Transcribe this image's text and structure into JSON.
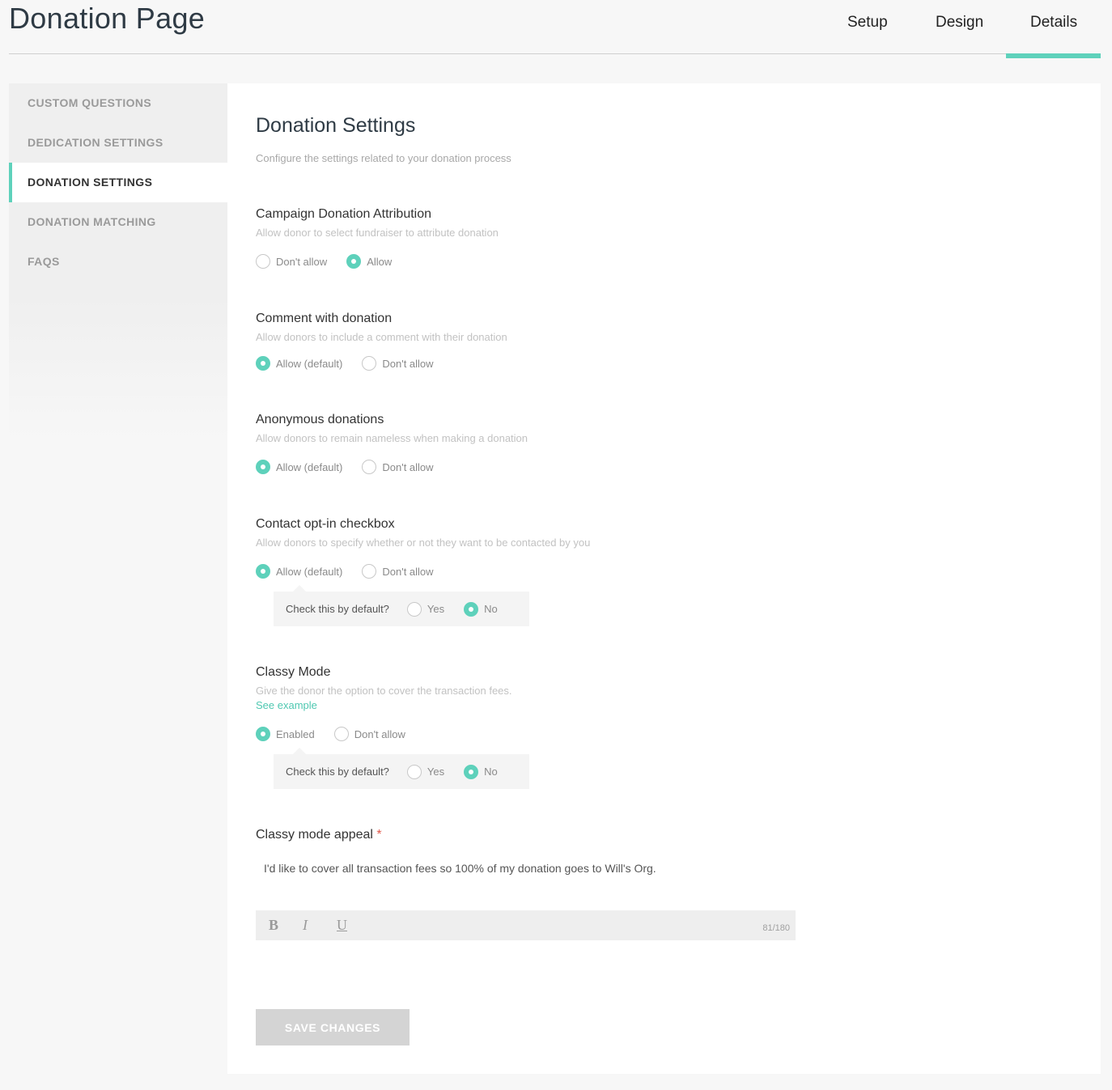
{
  "header": {
    "title": "Donation Page",
    "tabs": [
      {
        "label": "Setup"
      },
      {
        "label": "Design"
      },
      {
        "label": "Details"
      }
    ],
    "active_tab": "Details",
    "accent_color": "#5ed1bb"
  },
  "sidebar": {
    "items": [
      {
        "label": "CUSTOM QUESTIONS"
      },
      {
        "label": "DEDICATION SETTINGS"
      },
      {
        "label": "DONATION SETTINGS"
      },
      {
        "label": "DONATION MATCHING"
      },
      {
        "label": "FAQS"
      }
    ],
    "active": "DONATION SETTINGS"
  },
  "main": {
    "title": "Donation Settings",
    "subtitle": "Configure the settings related to your donation process",
    "sections": {
      "attribution": {
        "title": "Campaign Donation Attribution",
        "desc": "Allow donor to select fundraiser to attribute donation",
        "options": [
          "Don't allow",
          "Allow"
        ],
        "selected": "Allow"
      },
      "comment": {
        "title": "Comment with donation",
        "desc": "Allow donors to include a comment with their donation",
        "options": [
          "Allow (default)",
          "Don't allow"
        ],
        "selected": "Allow (default)"
      },
      "anonymous": {
        "title": "Anonymous donations",
        "desc": "Allow donors to remain nameless when making a donation",
        "options": [
          "Allow (default)",
          "Don't allow"
        ],
        "selected": "Allow (default)"
      },
      "optin": {
        "title": "Contact opt-in checkbox",
        "desc": "Allow donors to specify whether or not they want to be contacted by you",
        "options": [
          "Allow (default)",
          "Don't allow"
        ],
        "selected": "Allow (default)",
        "sub_question": "Check this by default?",
        "sub_options": [
          "Yes",
          "No"
        ],
        "sub_selected": "No"
      },
      "classy": {
        "title": "Classy Mode",
        "desc": "Give the donor the option to cover the transaction fees.",
        "link": "See example",
        "options": [
          "Enabled",
          "Don't allow"
        ],
        "selected": "Enabled",
        "sub_question": "Check this by default?",
        "sub_options": [
          "Yes",
          "No"
        ],
        "sub_selected": "No"
      },
      "appeal": {
        "title": "Classy mode appeal",
        "required_mark": "*",
        "text": "I'd like to cover all transaction fees so 100% of my donation goes to Will's Org.",
        "format_buttons": [
          "B",
          "I",
          "U"
        ],
        "counter": "81/180"
      }
    },
    "save_label": "SAVE CHANGES"
  }
}
